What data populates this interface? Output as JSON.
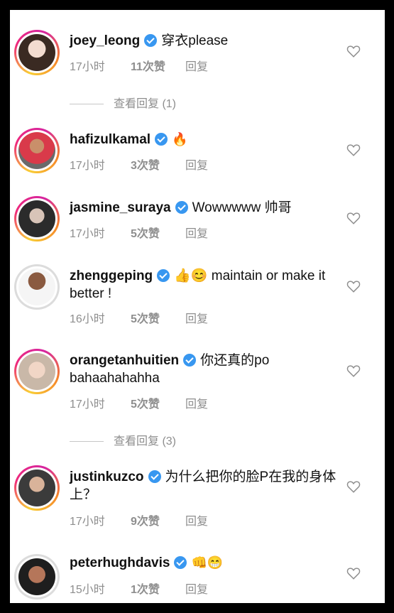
{
  "reply_label": "回复",
  "colors": {
    "verified": "#3897f0",
    "meta_text": "#8e8e8e"
  },
  "comments": [
    {
      "username": "joey_leong",
      "text": "穿衣please",
      "time": "17小时",
      "likes": "11次赞",
      "view_replies": "查看回复 (1)"
    },
    {
      "username": "hafizulkamal",
      "text": "🔥",
      "time": "17小时",
      "likes": "3次赞"
    },
    {
      "username": "jasmine_suraya",
      "text": "Wowwwww 帅哥",
      "time": "17小时",
      "likes": "5次赞"
    },
    {
      "username": "zhenggeping",
      "text": "👍😊 maintain or make it  better !",
      "time": "16小时",
      "likes": "5次赞"
    },
    {
      "username": "orangetanhuitien",
      "text": "你还真的po bahaahahahha",
      "time": "17小时",
      "likes": "5次赞",
      "view_replies": "查看回复 (3)"
    },
    {
      "username": "justinkuzco",
      "text": "为什么把你的脸P在我的身体上？",
      "time": "17小时",
      "likes": "9次赞"
    },
    {
      "username": "peterhughdavis",
      "text": "👊😁",
      "time": "15小时",
      "likes": "1次赞"
    }
  ]
}
